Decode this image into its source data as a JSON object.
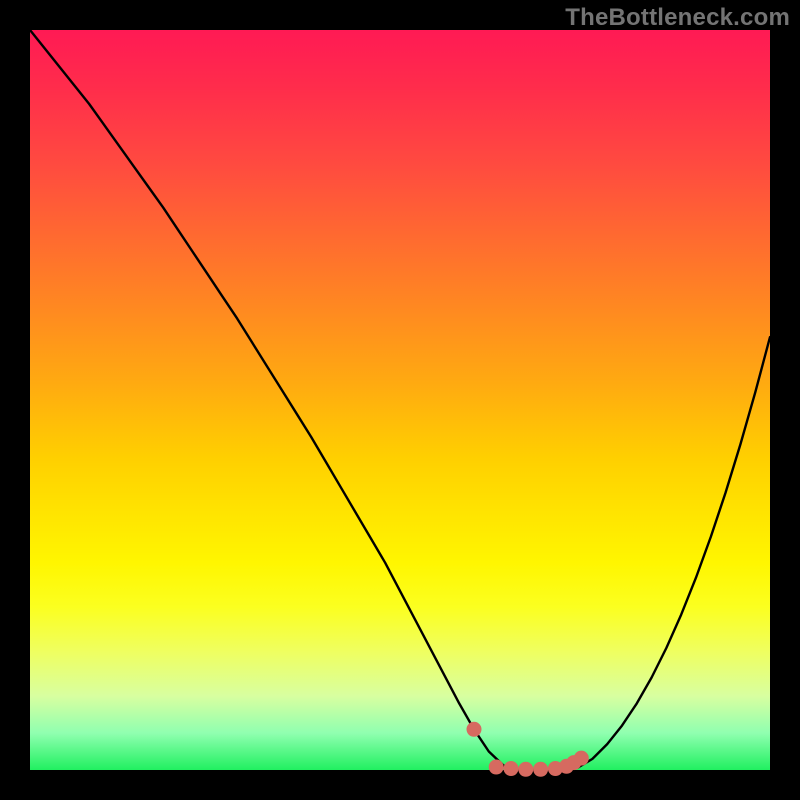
{
  "watermark": "TheBottleneck.com",
  "colors": {
    "background": "#000000",
    "curve_stroke": "#000000",
    "marker_fill": "#d66a60",
    "gradient_top": "#ff1a54",
    "gradient_bottom": "#20f060"
  },
  "chart_data": {
    "type": "line",
    "title": "",
    "xlabel": "",
    "ylabel": "",
    "xlim": [
      0,
      100
    ],
    "ylim": [
      0,
      100
    ],
    "legend": false,
    "grid": false,
    "x": [
      0,
      2,
      4,
      6,
      8,
      10,
      12,
      14,
      16,
      18,
      20,
      22,
      24,
      26,
      28,
      30,
      32,
      34,
      36,
      38,
      40,
      42,
      44,
      46,
      48,
      50,
      52,
      54,
      56,
      58,
      60,
      62,
      64,
      66,
      68,
      70,
      72,
      74,
      76,
      78,
      80,
      82,
      84,
      86,
      88,
      90,
      92,
      94,
      96,
      98,
      100
    ],
    "series": [
      {
        "name": "bottleneck-curve",
        "values": [
          100,
          97.5,
          95,
          92.5,
          90,
          87.2,
          84.4,
          81.6,
          78.8,
          76,
          73,
          70,
          67,
          64,
          61,
          57.8,
          54.6,
          51.4,
          48.2,
          45,
          41.6,
          38.2,
          34.8,
          31.4,
          28,
          24.2,
          20.4,
          16.6,
          12.8,
          9,
          5.5,
          2.5,
          0.6,
          0,
          0,
          0,
          0,
          0.3,
          1.5,
          3.5,
          6,
          9,
          12.5,
          16.5,
          21,
          26,
          31.5,
          37.5,
          44,
          51,
          58.5
        ]
      }
    ],
    "markers": [
      {
        "x": 60,
        "y": 5.5
      },
      {
        "x": 63,
        "y": 0.4
      },
      {
        "x": 65,
        "y": 0.2
      },
      {
        "x": 67,
        "y": 0.1
      },
      {
        "x": 69,
        "y": 0.1
      },
      {
        "x": 71,
        "y": 0.2
      },
      {
        "x": 72.5,
        "y": 0.5
      },
      {
        "x": 73.5,
        "y": 1.0
      },
      {
        "x": 74.5,
        "y": 1.6
      }
    ]
  }
}
